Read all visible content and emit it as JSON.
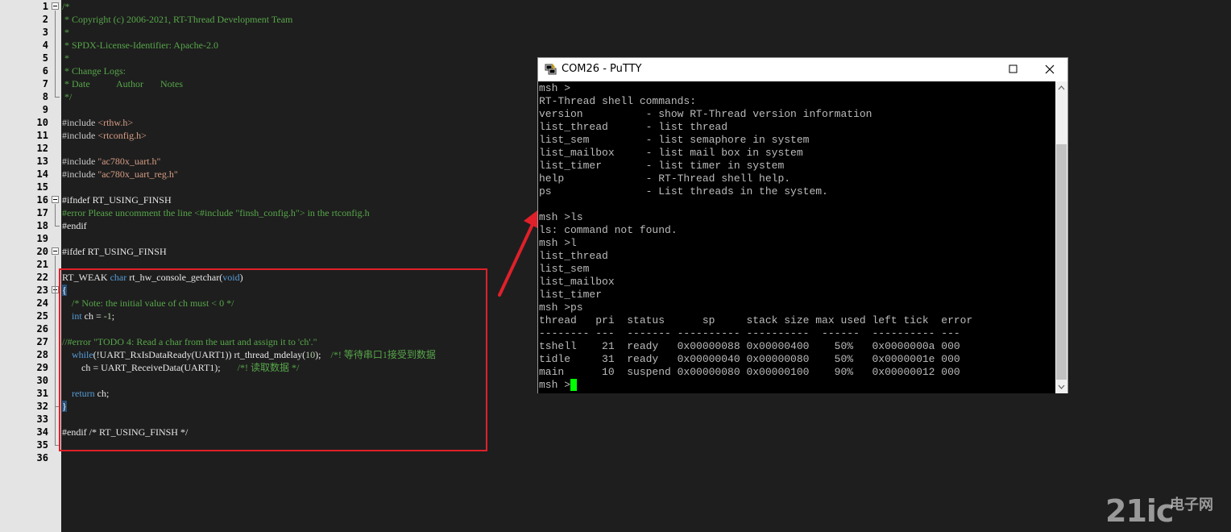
{
  "editor": {
    "line_numbers": [
      "1",
      "2",
      "3",
      "4",
      "5",
      "6",
      "7",
      "8",
      "9",
      "10",
      "11",
      "12",
      "13",
      "14",
      "15",
      "16",
      "17",
      "18",
      "19",
      "20",
      "21",
      "22",
      "23",
      "24",
      "25",
      "26",
      "27",
      "28",
      "29",
      "30",
      "31",
      "32",
      "33",
      "34",
      "35",
      "36"
    ],
    "lines": [
      "/*",
      " * Copyright (c) 2006-2021, RT-Thread Development Team",
      " *",
      " * SPDX-License-Identifier: Apache-2.0",
      " *",
      " * Change Logs:",
      " * Date           Author       Notes",
      " */",
      "",
      "#include <rthw.h>",
      "#include <rtconfig.h>",
      "",
      "#include \"ac780x_uart.h\"",
      "#include \"ac780x_uart_reg.h\"",
      "",
      "#ifndef RT_USING_FINSH",
      "#error Please uncomment the line <#include \"finsh_config.h\"> in the rtconfig.h",
      "#endif",
      "",
      "#ifdef RT_USING_FINSH",
      "",
      "RT_WEAK char rt_hw_console_getchar(void)",
      "{",
      "    /* Note: the initial value of ch must < 0 */",
      "    int ch = -1;",
      "",
      "//#error \"TODO 4: Read a char from the uart and assign it to 'ch'.\"",
      "    while(!UART_RxIsDataReady(UART1)) rt_thread_mdelay(10);    /*! 等待串口1接受到数据",
      "        ch = UART_ReceiveData(UART1);       /*! 读取数据 */",
      "",
      "    return ch;",
      "}",
      "",
      "#endif /* RT_USING_FINSH */",
      "",
      ""
    ]
  },
  "putty": {
    "title": "COM26 - PuTTY",
    "terminal_lines": [
      "msh >",
      "RT-Thread shell commands:",
      "version          - show RT-Thread version information",
      "list_thread      - list thread",
      "list_sem         - list semaphore in system",
      "list_mailbox     - list mail box in system",
      "list_timer       - list timer in system",
      "help             - RT-Thread shell help.",
      "ps               - List threads in the system.",
      "",
      "msh >ls",
      "ls: command not found.",
      "msh >l",
      "list_thread",
      "list_sem",
      "list_mailbox",
      "list_timer",
      "msh >ps",
      "thread   pri  status      sp     stack size max used left tick  error",
      "-------- ---  ------- ---------- ----------  ------  ---------- ---",
      "tshell    21  ready   0x00000088 0x00000400    50%   0x0000000a 000",
      "tidle     31  ready   0x00000040 0x00000080    50%   0x0000001e 000",
      "main      10  suspend 0x00000080 0x00000100    90%   0x00000012 000",
      "msh >"
    ]
  },
  "watermark": {
    "logo": "21ic",
    "sub": "电子网"
  },
  "colors": {
    "annotation": "#e0202a",
    "terminal_bg": "#000000",
    "terminal_fg": "#bbbbbb",
    "cursor": "#00ff00"
  },
  "icons": [
    "putty-app-icon",
    "minimize-icon",
    "maximize-icon",
    "close-icon"
  ]
}
